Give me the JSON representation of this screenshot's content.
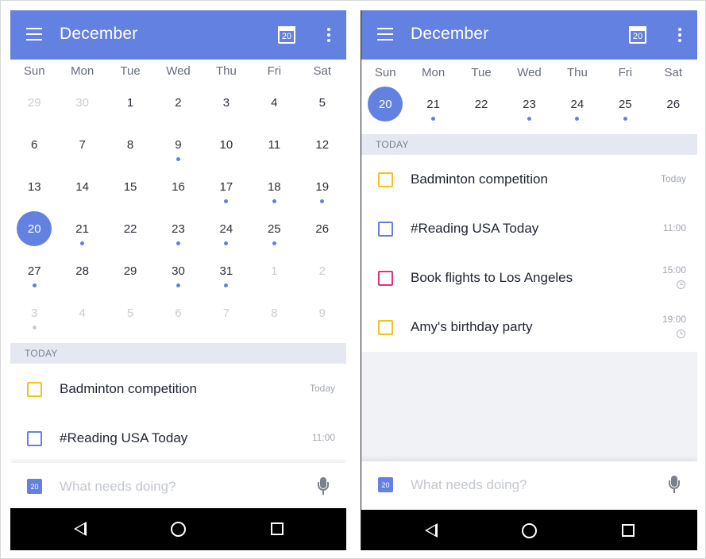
{
  "colors": {
    "accent": "#6381e0",
    "yellow": "#f2c21b",
    "blue_box": "#6381e0",
    "pink_box": "#e0337a",
    "section_bg": "#e5e8f0"
  },
  "month_title": "December",
  "today_icon_num": "20",
  "weekdays": [
    "Sun",
    "Mon",
    "Tue",
    "Wed",
    "Thu",
    "Fri",
    "Sat"
  ],
  "month_grid": [
    [
      {
        "d": "29",
        "dim": true,
        "dot": false
      },
      {
        "d": "30",
        "dim": true,
        "dot": false
      },
      {
        "d": "1",
        "dim": false,
        "dot": false
      },
      {
        "d": "2",
        "dim": false,
        "dot": false
      },
      {
        "d": "3",
        "dim": false,
        "dot": false
      },
      {
        "d": "4",
        "dim": false,
        "dot": false
      },
      {
        "d": "5",
        "dim": false,
        "dot": false
      }
    ],
    [
      {
        "d": "6",
        "dim": false,
        "dot": false
      },
      {
        "d": "7",
        "dim": false,
        "dot": false
      },
      {
        "d": "8",
        "dim": false,
        "dot": false
      },
      {
        "d": "9",
        "dim": false,
        "dot": true
      },
      {
        "d": "10",
        "dim": false,
        "dot": false
      },
      {
        "d": "11",
        "dim": false,
        "dot": false
      },
      {
        "d": "12",
        "dim": false,
        "dot": false
      }
    ],
    [
      {
        "d": "13",
        "dim": false,
        "dot": false
      },
      {
        "d": "14",
        "dim": false,
        "dot": false
      },
      {
        "d": "15",
        "dim": false,
        "dot": false
      },
      {
        "d": "16",
        "dim": false,
        "dot": false
      },
      {
        "d": "17",
        "dim": false,
        "dot": true
      },
      {
        "d": "18",
        "dim": false,
        "dot": true
      },
      {
        "d": "19",
        "dim": false,
        "dot": true
      }
    ],
    [
      {
        "d": "20",
        "dim": false,
        "dot": false,
        "sel": true
      },
      {
        "d": "21",
        "dim": false,
        "dot": true
      },
      {
        "d": "22",
        "dim": false,
        "dot": false
      },
      {
        "d": "23",
        "dim": false,
        "dot": true
      },
      {
        "d": "24",
        "dim": false,
        "dot": true
      },
      {
        "d": "25",
        "dim": false,
        "dot": true
      },
      {
        "d": "26",
        "dim": false,
        "dot": false
      }
    ],
    [
      {
        "d": "27",
        "dim": false,
        "dot": true
      },
      {
        "d": "28",
        "dim": false,
        "dot": false
      },
      {
        "d": "29",
        "dim": false,
        "dot": false
      },
      {
        "d": "30",
        "dim": false,
        "dot": true
      },
      {
        "d": "31",
        "dim": false,
        "dot": true
      },
      {
        "d": "1",
        "dim": true,
        "dot": false
      },
      {
        "d": "2",
        "dim": true,
        "dot": false
      }
    ],
    [
      {
        "d": "3",
        "dim": true,
        "dot": true
      },
      {
        "d": "4",
        "dim": true,
        "dot": false
      },
      {
        "d": "5",
        "dim": true,
        "dot": false
      },
      {
        "d": "6",
        "dim": true,
        "dot": false
      },
      {
        "d": "7",
        "dim": true,
        "dot": false
      },
      {
        "d": "8",
        "dim": true,
        "dot": false
      },
      {
        "d": "9",
        "dim": true,
        "dot": false
      }
    ]
  ],
  "week_row": [
    {
      "d": "20",
      "dot": false,
      "sel": true
    },
    {
      "d": "21",
      "dot": true
    },
    {
      "d": "22",
      "dot": false
    },
    {
      "d": "23",
      "dot": true
    },
    {
      "d": "24",
      "dot": true
    },
    {
      "d": "25",
      "dot": true
    },
    {
      "d": "26",
      "dot": false
    }
  ],
  "section_label": "TODAY",
  "tasks": [
    {
      "label": "Badminton competition",
      "time": "Today",
      "box": "yellow",
      "alarm": false
    },
    {
      "label": "#Reading  USA Today",
      "time": "11:00",
      "box": "blue",
      "alarm": false
    },
    {
      "label": "Book flights to Los Angeles",
      "time": "15:00",
      "box": "pink",
      "alarm": true
    },
    {
      "label": "Amy's birthday party",
      "time": "19:00",
      "box": "yellow",
      "alarm": true
    }
  ],
  "input": {
    "placeholder": "What needs doing?",
    "cal_num": "20"
  },
  "icons": [
    "menu-icon",
    "calendar-today-icon",
    "more-vert-icon",
    "checkbox-icon",
    "alarm-icon",
    "calendar-small-icon",
    "mic-icon",
    "nav-back-icon",
    "nav-home-icon",
    "nav-recent-icon"
  ]
}
